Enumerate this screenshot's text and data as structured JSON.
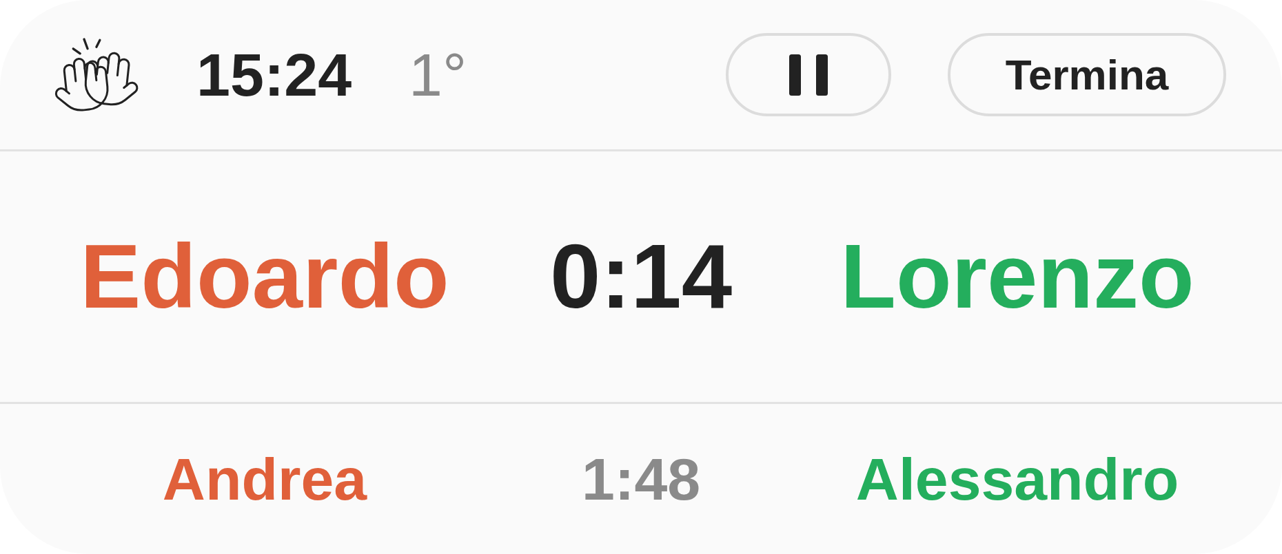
{
  "header": {
    "clock": "15:24",
    "period": "1°",
    "end_button": {
      "label": "Termina"
    }
  },
  "matches": [
    {
      "kind": "current",
      "time": "0:14",
      "players": [
        {
          "name": "Edoardo",
          "color": "#e0603a"
        },
        {
          "name": "Lorenzo",
          "color": "#24ae5d"
        }
      ]
    },
    {
      "kind": "upcoming",
      "time": "1:48",
      "players": [
        {
          "name": "Andrea",
          "color": "#e0603a"
        },
        {
          "name": "Alessandro",
          "color": "#24ae5d"
        }
      ]
    }
  ]
}
